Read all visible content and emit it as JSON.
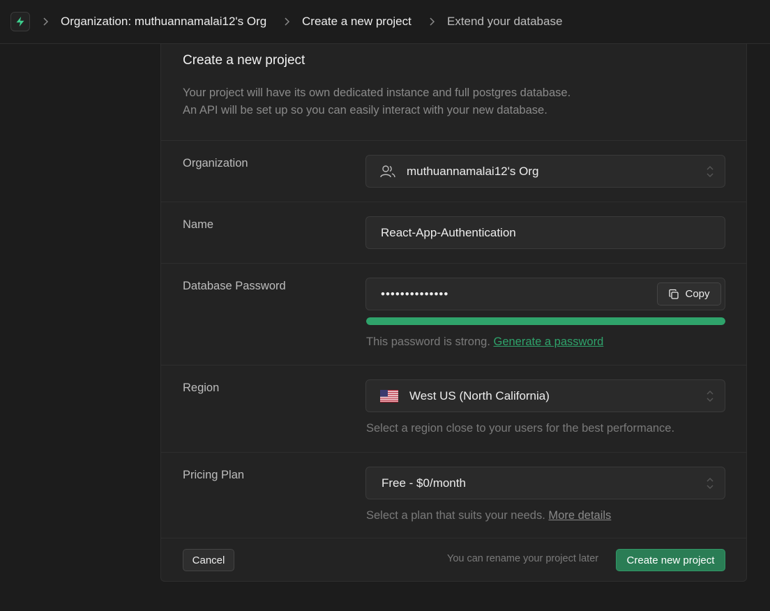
{
  "breadcrumb": {
    "items": [
      {
        "label": "Organization: muthuannamalai12's Org"
      },
      {
        "label": "Create a new project"
      },
      {
        "label": "Extend your database"
      }
    ]
  },
  "card": {
    "title": "Create a new project",
    "description_line1": "Your project will have its own dedicated instance and full postgres database.",
    "description_line2": "An API will be set up so you can easily interact with your new database."
  },
  "organization": {
    "label": "Organization",
    "value": "muthuannamalai12's Org"
  },
  "name": {
    "label": "Name",
    "value": "React-App-Authentication"
  },
  "password": {
    "label": "Database Password",
    "value": "••••••••••••••",
    "copy_label": "Copy",
    "strength_fraction": 1.0,
    "strength_text": "This password is strong.",
    "generate_link": "Generate a password"
  },
  "region": {
    "label": "Region",
    "value": "West US (North California)",
    "help": "Select a region close to your users for the best performance."
  },
  "pricing": {
    "label": "Pricing Plan",
    "value": "Free - $0/month",
    "help": "Select a plan that suits your needs.",
    "details_link": "More details"
  },
  "footer": {
    "cancel_label": "Cancel",
    "note": "You can rename your project later",
    "create_label": "Create new project"
  },
  "colors": {
    "accent": "#3ecf8e",
    "background": "#1c1c1c",
    "card": "#232323"
  }
}
